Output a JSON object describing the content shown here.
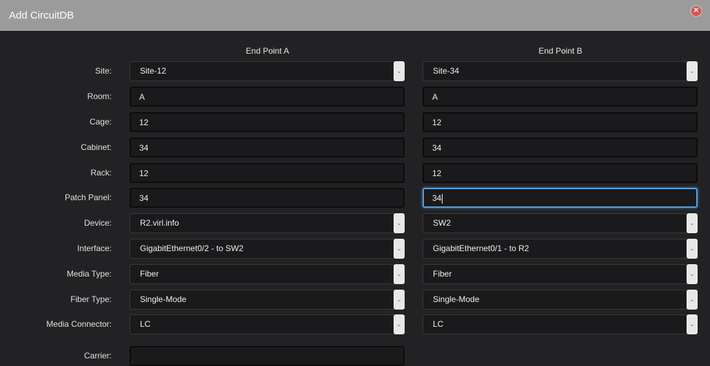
{
  "title": "Add CircuitDB",
  "columns": {
    "a": "End Point A",
    "b": "End Point B"
  },
  "rows": [
    {
      "label": "Site:",
      "type": "select",
      "a": "Site-12",
      "b": "Site-34"
    },
    {
      "label": "Room:",
      "type": "input",
      "a": "A",
      "b": "A"
    },
    {
      "label": "Cage:",
      "type": "input",
      "a": "12",
      "b": "12"
    },
    {
      "label": "Cabinet:",
      "type": "input",
      "a": "34",
      "b": "34"
    },
    {
      "label": "Rack:",
      "type": "input",
      "a": "12",
      "b": "12"
    },
    {
      "label": "Patch Panel:",
      "type": "input",
      "a": "34",
      "b": "34"
    },
    {
      "label": "Device:",
      "type": "select",
      "a": "R2.virl.info",
      "b": "SW2"
    },
    {
      "label": "Interface:",
      "type": "select",
      "a": "GigabitEthernet0/2 - to SW2",
      "b": "GigabitEthernet0/1 - to R2"
    },
    {
      "label": "Media Type:",
      "type": "select",
      "a": "Fiber",
      "b": "Fiber"
    },
    {
      "label": "Fiber Type:",
      "type": "select",
      "a": "Single-Mode",
      "b": "Single-Mode"
    },
    {
      "label": "Media Connector:",
      "type": "select",
      "a": "LC",
      "b": "LC"
    },
    {
      "label": "Carrier:",
      "type": "input",
      "a": ""
    }
  ]
}
